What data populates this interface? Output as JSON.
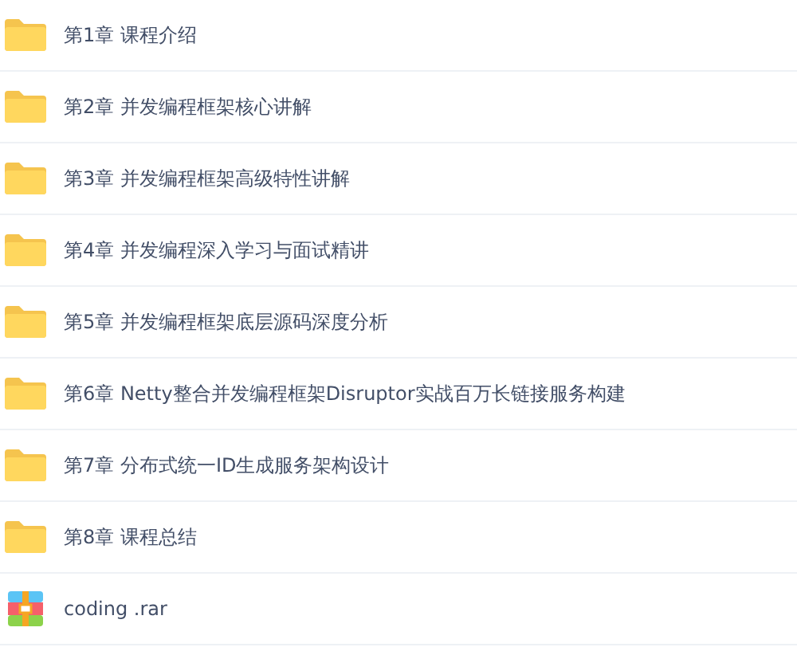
{
  "files": [
    {
      "kind": "folder",
      "name": "第1章 课程介绍"
    },
    {
      "kind": "folder",
      "name": "第2章 并发编程框架核心讲解"
    },
    {
      "kind": "folder",
      "name": "第3章 并发编程框架高级特性讲解"
    },
    {
      "kind": "folder",
      "name": "第4章 并发编程深入学习与面试精讲"
    },
    {
      "kind": "folder",
      "name": "第5章 并发编程框架底层源码深度分析"
    },
    {
      "kind": "folder",
      "name": "第6章 Netty整合并发编程框架Disruptor实战百万长链接服务构建"
    },
    {
      "kind": "folder",
      "name": "第7章 分布式统一ID生成服务架构设计"
    },
    {
      "kind": "folder",
      "name": "第8章 课程总结"
    },
    {
      "kind": "archive",
      "name": "coding .rar"
    }
  ]
}
